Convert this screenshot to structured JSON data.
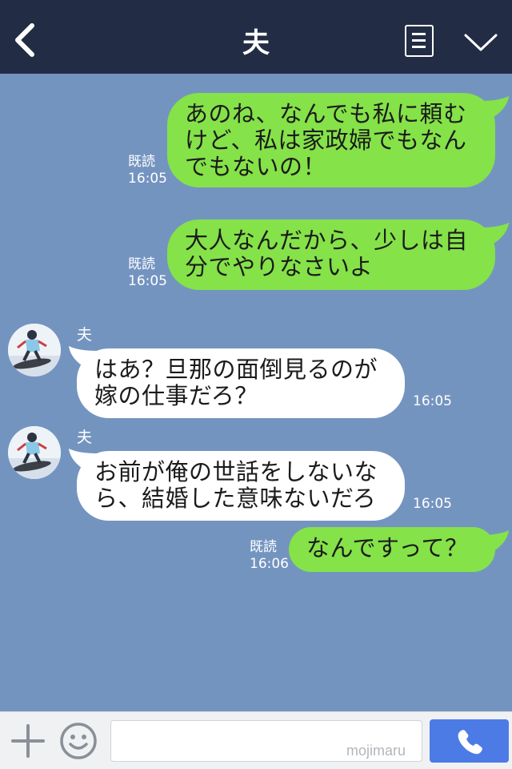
{
  "header": {
    "title": "夫",
    "back_icon": "chevron-left-icon",
    "menu_icon": "notes-icon",
    "expand_icon": "chevron-down-icon",
    "background": "#232c45"
  },
  "chat": {
    "background": "#7494c0",
    "messages": [
      {
        "side": "me",
        "lines": [
          "あのね、なんでも私に頼む",
          "けど、私は家政婦でもなん",
          "でもないの！"
        ],
        "read_label": "既読",
        "time": "16:05"
      },
      {
        "side": "me",
        "lines": [
          "大人なんだから、少しは自",
          "分でやりなさいよ"
        ],
        "read_label": "既読",
        "time": "16:05"
      },
      {
        "side": "them",
        "sender": "夫",
        "lines": [
          "はあ？旦那の面倒見るのが",
          "嫁の仕事だろ？"
        ],
        "time": "16:05"
      },
      {
        "side": "them",
        "sender": "夫",
        "lines": [
          "お前が俺の世話をしないな",
          "ら、結婚した意味ないだろ"
        ],
        "time": "16:05"
      },
      {
        "side": "me",
        "lines": [
          "なんですって？"
        ],
        "read_label": "既読",
        "time": "16:06"
      }
    ]
  },
  "input_bar": {
    "plus_icon": "plus-icon",
    "emoji_icon": "smiley-icon",
    "input_value": "",
    "watermark": "mojimaru",
    "call_icon": "phone-icon",
    "call_color": "#4d7be6"
  },
  "colors": {
    "my_bubble": "#85e249",
    "their_bubble": "#ffffff"
  }
}
